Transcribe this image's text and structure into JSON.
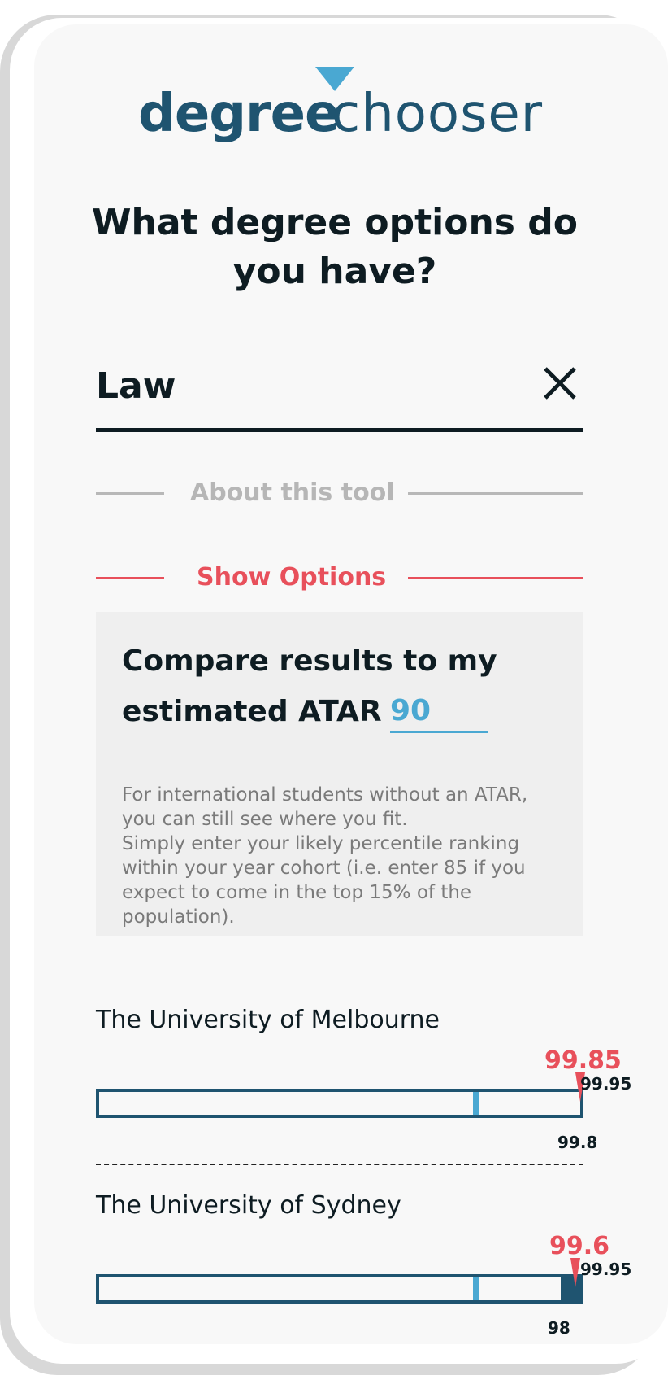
{
  "logo": {
    "part1": "degree",
    "part2": "chooser",
    "accent_color": "#4aa8d2",
    "brand_color": "#1f5470"
  },
  "title": "What degree options do you have?",
  "search": {
    "value": "Law",
    "clear_icon": "close-icon"
  },
  "links": {
    "about": "About this tool",
    "show_options": "Show Options"
  },
  "compare": {
    "title": "Compare results to my estimated ATAR",
    "atar_value": "90",
    "note_line1": "For international students without an ATAR, you can still see where you fit.",
    "note_line2": "Simply enter your likely percentile ranking within your year cohort (i.e. enter 85 if you expect to come in the top 15% of the population)."
  },
  "results": [
    {
      "name": "The University of Melbourne",
      "score": "99.85",
      "max": "99.95",
      "min": "99.8"
    },
    {
      "name": "The University of Sydney",
      "score": "99.6",
      "max": "99.95",
      "min": "98"
    }
  ]
}
